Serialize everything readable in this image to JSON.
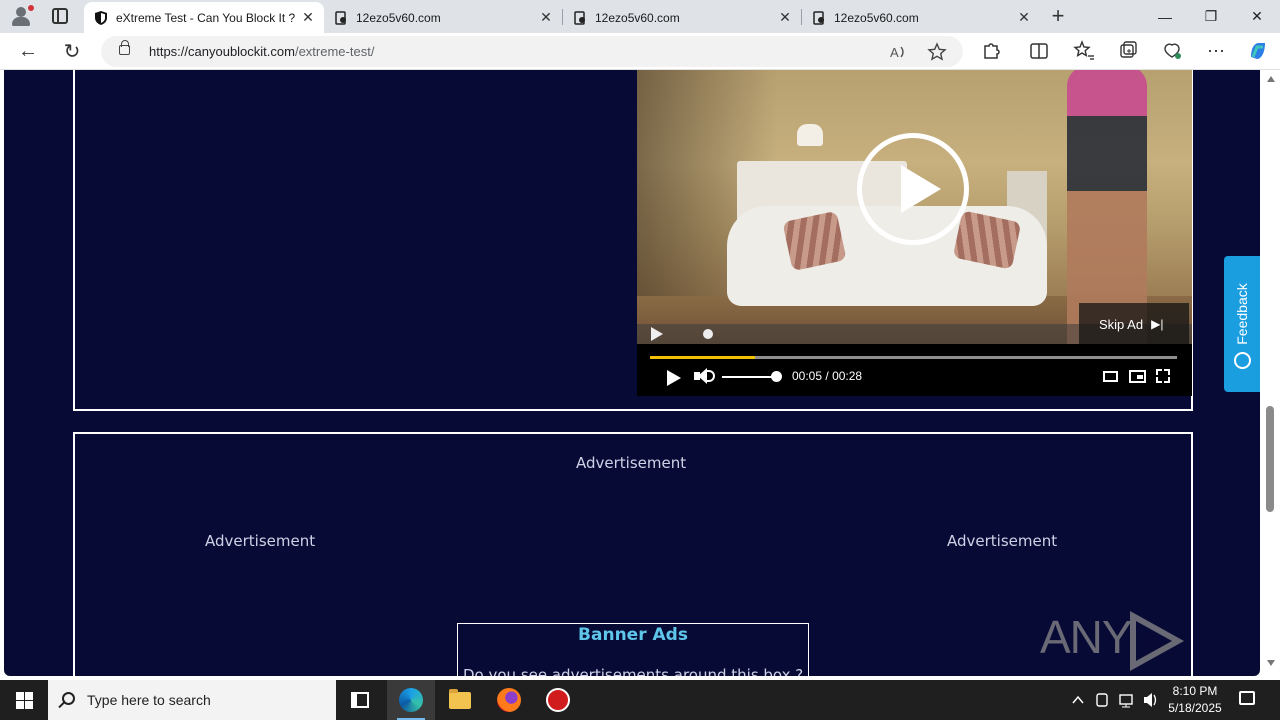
{
  "browser": {
    "tabs": [
      {
        "title": "eXtreme Test - Can You Block It ?",
        "active": true,
        "icon": "shield-icon"
      },
      {
        "title": "12ezo5v60.com",
        "active": false,
        "icon": "page-icon"
      },
      {
        "title": "12ezo5v60.com",
        "active": false,
        "icon": "page-icon"
      },
      {
        "title": "12ezo5v60.com",
        "active": false,
        "icon": "page-icon"
      }
    ],
    "close_glyph": "✕",
    "new_tab_glyph": "+",
    "window_controls": {
      "minimize": "—",
      "maximize": "❐",
      "close": "✕"
    },
    "url": {
      "domain": "https://canyoublockit.com",
      "path": "/extreme-test/"
    },
    "toolbar_glyphs": {
      "back": "←",
      "refresh": "↻",
      "more": "⋯"
    }
  },
  "video_player": {
    "skip_label": "Skip Ad",
    "skip_glyph": "▶|",
    "current_time": "00:05",
    "duration": "00:28",
    "time_separator": "/",
    "progress_fraction": 0.2,
    "volume_fraction": 1.0,
    "colors": {
      "progress": "#f2c200"
    }
  },
  "ads": {
    "top_label": "Advertisement",
    "left_label": "Advertisement",
    "right_label": "Advertisement",
    "banner_title": "Banner Ads",
    "banner_text": "Do you see advertisements around this box ?"
  },
  "feedback": {
    "label": "Feedback"
  },
  "watermark": {
    "left": "ANY",
    "right": "RUN"
  },
  "taskbar": {
    "search_placeholder": "Type here to search",
    "time": "8:10 PM",
    "date": "5/18/2025"
  },
  "colors": {
    "page_bg": "#080a36",
    "banner_title": "#5ec6e8",
    "feedback": "#1a9ee0"
  }
}
